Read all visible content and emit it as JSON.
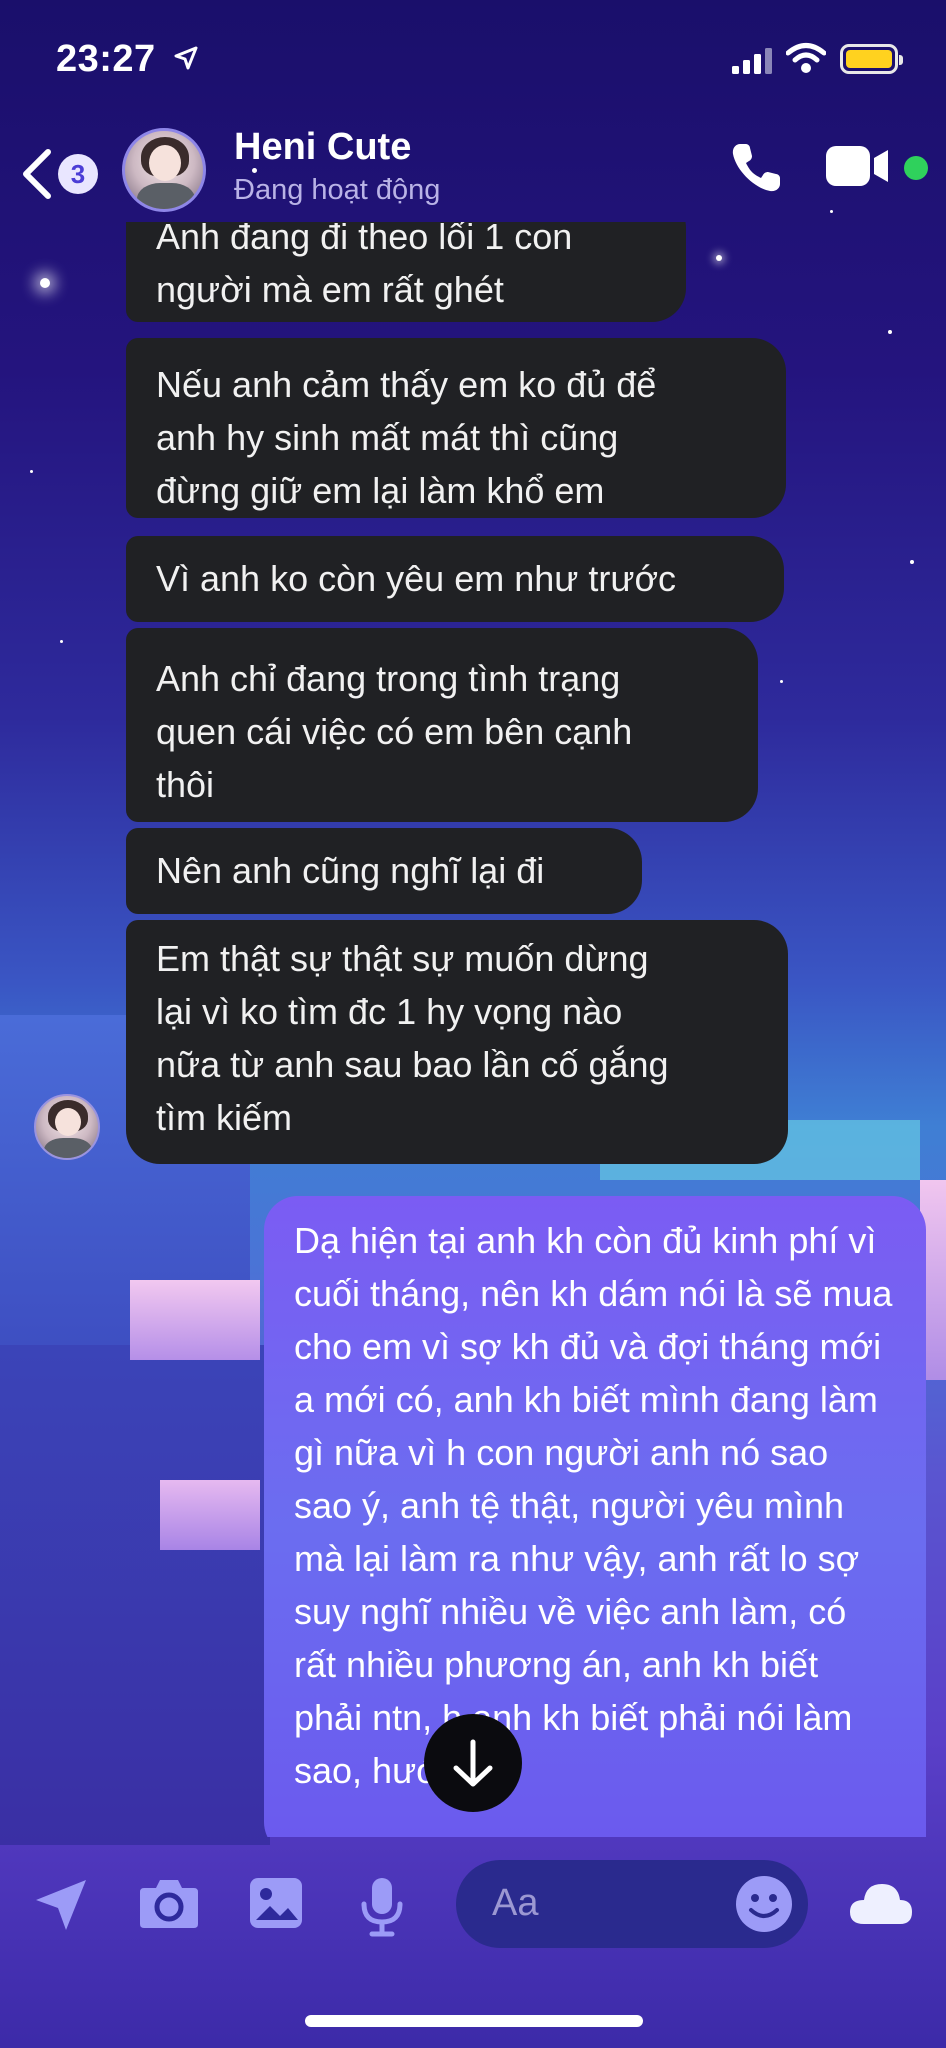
{
  "status_bar": {
    "time": "23:27"
  },
  "header": {
    "back_badge": "3",
    "contact_name": "Heni Cute",
    "contact_status": "Đang hoạt động"
  },
  "messages": {
    "received": [
      "Anh đang đi theo lối 1 con\nngười mà em rất ghét",
      "Nếu anh cảm thấy em ko đủ để\nanh hy sinh mất mát thì cũng\nđừng giữ em lại làm khổ em",
      "Vì anh ko còn yêu em như trước",
      "Anh chỉ đang trong tình trạng\nquen cái việc có em bên cạnh\nthôi",
      "Nên anh cũng nghĩ lại đi",
      "Em thật sự thật sự muốn dừng\nlại vì ko tìm đc 1 hy vọng nào\nnữa từ anh sau bao lần cố gắng\ntìm kiếm"
    ],
    "sent": "Dạ hiện tại anh kh còn đủ kinh phí vì cuối tháng, nên kh dám nói là sẽ mua cho em vì sợ kh đủ và đợi tháng mới a mới có, anh kh biết mình đang làm gì nữa vì h con người anh nó sao sao ý, anh tệ thật, người yêu mình mà lại làm ra như vậy, anh rất lo sợ suy nghĩ nhiều về việc anh làm, có rất nhiều phương án, anh kh biết phải ntn, h anh kh biết phải nói làm sao, hướng"
  },
  "composer": {
    "placeholder": "Aa"
  },
  "colors": {
    "received_bubble": "#202124",
    "sent_bubble": "#7063f0",
    "online": "#2fd15c",
    "accent": "#9c9bf7"
  },
  "icons": [
    "location-arrow-icon",
    "signal-icon",
    "wifi-icon",
    "battery-icon",
    "back-chevron-icon",
    "phone-icon",
    "video-icon",
    "send-location-icon",
    "camera-icon",
    "image-icon",
    "microphone-icon",
    "emoji-icon",
    "cloud-icon",
    "arrow-down-icon"
  ]
}
